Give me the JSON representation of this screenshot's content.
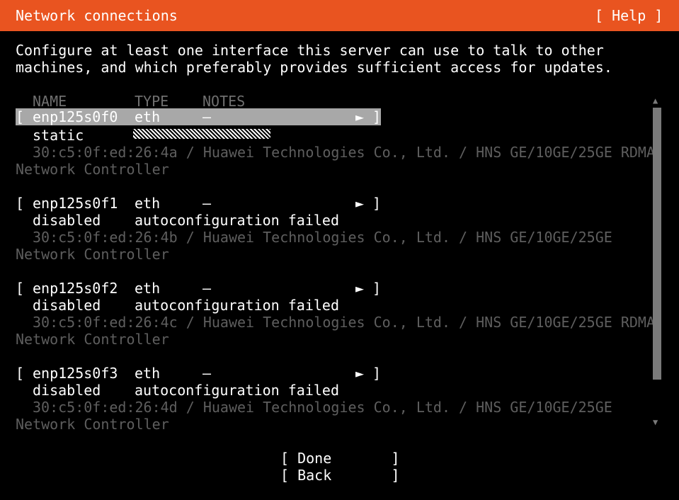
{
  "header": {
    "title": "Network connections",
    "help": "[ Help ]"
  },
  "intro": {
    "line1": "Configure at least one interface this server can use to talk to other",
    "line2": "machines, and which preferably provides sufficient access for updates."
  },
  "columns": {
    "name": "NAME",
    "type": "TYPE",
    "notes": "NOTES"
  },
  "interfaces": [
    {
      "open": "[",
      "name": "enp125s0f0",
      "type": "eth",
      "notes": "–",
      "arrow": "►",
      "close": "]",
      "status": "static",
      "status_detail": "",
      "vendor_line1": "30:c5:0f:ed:26:4a / Huawei Technologies Co., Ltd. / HNS GE/10GE/25GE RDMA",
      "vendor_line2": "Network Controller"
    },
    {
      "open": "[",
      "name": "enp125s0f1",
      "type": "eth",
      "notes": "–",
      "arrow": "►",
      "close": "]",
      "status": "disabled",
      "status_detail": "autoconfiguration failed",
      "vendor_line1": "30:c5:0f:ed:26:4b / Huawei Technologies Co., Ltd. / HNS GE/10GE/25GE",
      "vendor_line2": "Network Controller"
    },
    {
      "open": "[",
      "name": "enp125s0f2",
      "type": "eth",
      "notes": "–",
      "arrow": "►",
      "close": "]",
      "status": "disabled",
      "status_detail": "autoconfiguration failed",
      "vendor_line1": "30:c5:0f:ed:26:4c / Huawei Technologies Co., Ltd. / HNS GE/10GE/25GE RDMA",
      "vendor_line2": "Network Controller"
    },
    {
      "open": "[",
      "name": "enp125s0f3",
      "type": "eth",
      "notes": "–",
      "arrow": "►",
      "close": "]",
      "status": "disabled",
      "status_detail": "autoconfiguration failed",
      "vendor_line1": "30:c5:0f:ed:26:4d / Huawei Technologies Co., Ltd. / HNS GE/10GE/25GE",
      "vendor_line2": "Network Controller"
    }
  ],
  "scrollbar": {
    "up": "▲",
    "down": "▼"
  },
  "buttons": {
    "done": "[ Done       ]",
    "back": "[ Back       ]"
  },
  "colors": {
    "header_bg": "#e95420",
    "selected_row_bg": "#a8a8a8",
    "dim_text": "#5e5e5e"
  }
}
